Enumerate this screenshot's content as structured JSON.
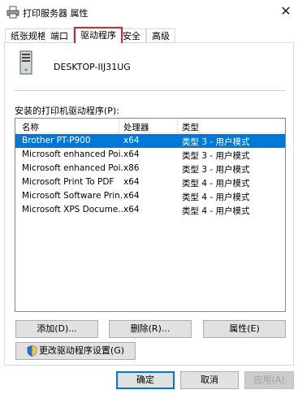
{
  "window": {
    "title": "打印服务器 属性",
    "close_glyph": "✕"
  },
  "tabs": [
    {
      "label": "纸张规格"
    },
    {
      "label": "端口"
    },
    {
      "label": "驱动程序"
    },
    {
      "label": "安全"
    },
    {
      "label": "高级"
    }
  ],
  "selected_tab": "驱动程序",
  "server": {
    "name": "DESKTOP-IIJ31UG"
  },
  "drivers_label": "安装的打印机驱动程序(P):",
  "columns": {
    "name": "名称",
    "processor": "处理器",
    "type": "类型"
  },
  "drivers": [
    {
      "name": "Brother PT-P900",
      "processor": "x64",
      "type": "类型 3 - 用户模式"
    },
    {
      "name": "Microsoft enhanced Poi...",
      "processor": "x64",
      "type": "类型 3 - 用户模式"
    },
    {
      "name": "Microsoft enhanced Poi...",
      "processor": "x86",
      "type": "类型 3 - 用户模式"
    },
    {
      "name": "Microsoft Print To PDF",
      "processor": "x64",
      "type": "类型 4 - 用户模式"
    },
    {
      "name": "Microsoft Software Prin...",
      "processor": "x64",
      "type": "类型 4 - 用户模式"
    },
    {
      "name": "Microsoft XPS Docume...",
      "processor": "x64",
      "type": "类型 4 - 用户模式"
    }
  ],
  "selected_driver": "Brother PT-P900",
  "buttons": {
    "add": "添加(D)...",
    "remove": "删除(R)...",
    "properties": "属性(E)",
    "change_settings": "更改驱动程序设置(G)",
    "ok": "确定",
    "cancel": "取消",
    "apply": "应用(A)"
  },
  "colors": {
    "selection": "#0078d7",
    "tab_highlight": "#d9262c"
  }
}
